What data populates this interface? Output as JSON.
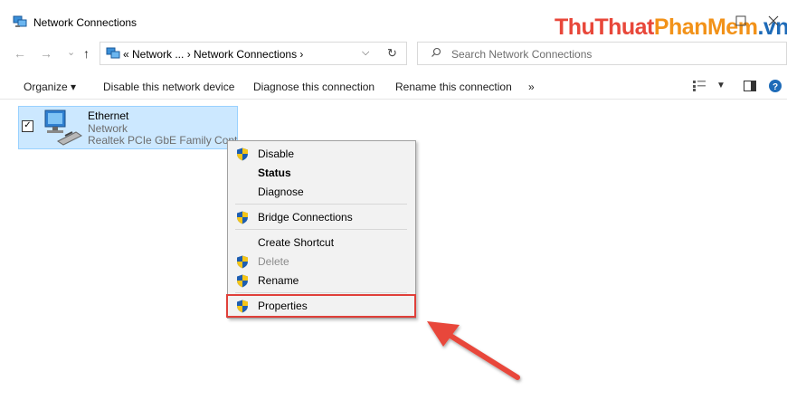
{
  "window": {
    "title": "Network Connections",
    "watermark": {
      "part1": "ThuThuat",
      "part2": "PhanMem",
      "part3": ".vn"
    }
  },
  "navigation": {
    "back": "←",
    "forward": "→",
    "history": "⌄",
    "up": "↑",
    "address_path": "« Network ... › Network Connections ›",
    "refresh": "↻",
    "search_placeholder": "Search Network Connections"
  },
  "commandbar": {
    "organize": "Organize ▾",
    "disable": "Disable this network device",
    "diagnose": "Diagnose this connection",
    "rename": "Rename this connection",
    "more": "»"
  },
  "item": {
    "checked": "☑",
    "name": "Ethernet",
    "status": "Network",
    "device": "Realtek PCIe GbE Family Cont..."
  },
  "context_menu": {
    "disable": "Disable",
    "status": "Status",
    "diagnose": "Diagnose",
    "bridge": "Bridge Connections",
    "shortcut": "Create Shortcut",
    "delete": "Delete",
    "rename": "Rename",
    "properties": "Properties"
  },
  "colors": {
    "highlight_box": "#e0403a",
    "selection": "#cce8ff",
    "accent": "#1e6bb8"
  }
}
